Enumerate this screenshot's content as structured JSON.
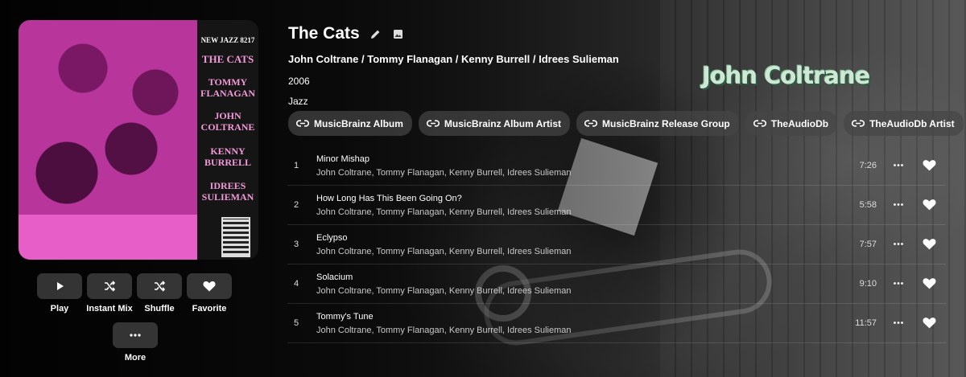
{
  "album": {
    "title": "The Cats",
    "artists": "John Coltrane / Tommy Flanagan / Kenny Burrell / Idrees Sulieman",
    "year": "2006",
    "genre": "Jazz"
  },
  "cover": {
    "catalog": "NEW JAZZ 8217",
    "lines": [
      "THE CATS",
      "TOMMY",
      "FLANAGAN",
      "JOHN",
      "COLTRANE",
      "KENNY",
      "BURRELL",
      "IDREES",
      "SULIEMAN"
    ]
  },
  "backdrop_logo": "John Coltrane",
  "actions": [
    {
      "label": "Play",
      "icon": "play-icon"
    },
    {
      "label": "Instant Mix",
      "icon": "shuffle-icon"
    },
    {
      "label": "Shuffle",
      "icon": "shuffle-icon"
    },
    {
      "label": "Favorite",
      "icon": "heart-icon"
    },
    {
      "label": "More",
      "icon": "more-horizontal-icon"
    }
  ],
  "links": [
    {
      "label": "MusicBrainz Album",
      "icon": "link-icon"
    },
    {
      "label": "MusicBrainz Album Artist",
      "icon": "link-icon"
    },
    {
      "label": "MusicBrainz Release Group",
      "icon": "link-icon"
    },
    {
      "label": "TheAudioDb",
      "icon": "link-icon"
    },
    {
      "label": "TheAudioDb Artist",
      "icon": "link-icon"
    }
  ],
  "tracks": [
    {
      "number": "1",
      "title": "Minor Mishap",
      "artists": "John Coltrane, Tommy Flanagan, Kenny Burrell, Idrees Sulieman",
      "duration": "7:26"
    },
    {
      "number": "2",
      "title": "How Long Has This Been Going On?",
      "artists": "John Coltrane, Tommy Flanagan, Kenny Burrell, Idrees Sulieman",
      "duration": "5:58"
    },
    {
      "number": "3",
      "title": "Eclypso",
      "artists": "John Coltrane, Tommy Flanagan, Kenny Burrell, Idrees Sulieman",
      "duration": "7:57"
    },
    {
      "number": "4",
      "title": "Solacium",
      "artists": "John Coltrane, Tommy Flanagan, Kenny Burrell, Idrees Sulieman",
      "duration": "9:10"
    },
    {
      "number": "5",
      "title": "Tommy's Tune",
      "artists": "John Coltrane, Tommy Flanagan, Kenny Burrell, Idrees Sulieman",
      "duration": "11:57"
    }
  ],
  "colors": {
    "cover_magenta": "#b8369c",
    "cover_band": "#e85ec9",
    "chip_bg": "#464646",
    "logo_green": "#cfe8d6"
  }
}
